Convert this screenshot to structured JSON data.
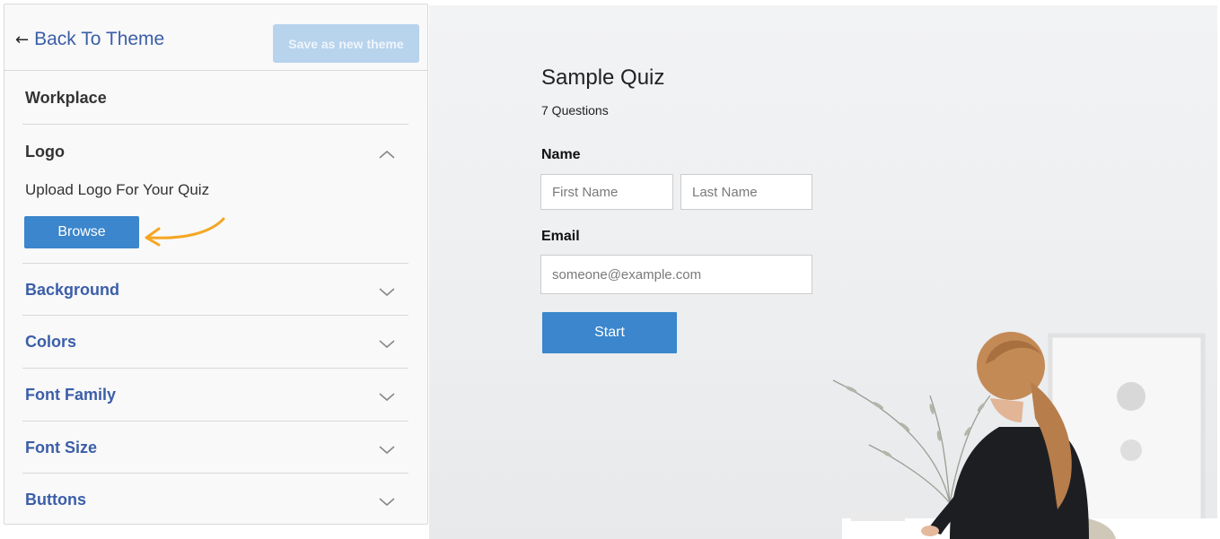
{
  "sidebar": {
    "back_label": "Back To Theme",
    "save_theme_label": "Save as new theme",
    "sections": {
      "workplace": "Workplace",
      "logo": "Logo",
      "logo_description": "Upload Logo For Your Quiz",
      "browse_label": "Browse",
      "background": "Background",
      "colors": "Colors",
      "font_family": "Font Family",
      "font_size": "Font Size",
      "buttons": "Buttons"
    },
    "expanded_section": "Logo"
  },
  "quiz": {
    "title": "Sample Quiz",
    "question_count": "7 Questions",
    "name_label": "Name",
    "first_name_placeholder": "First Name",
    "last_name_placeholder": "Last Name",
    "email_label": "Email",
    "email_placeholder": "someone@example.com",
    "start_label": "Start"
  },
  "colors": {
    "accent": "#3b86cc",
    "link": "#3b5ea8",
    "disabled_button": "#b8d3ec",
    "annotation_arrow": "#f5a623"
  },
  "icons": {
    "back": "left-arrow-icon",
    "expanded": "chevron-up-icon",
    "collapsed": "chevron-down-icon"
  }
}
